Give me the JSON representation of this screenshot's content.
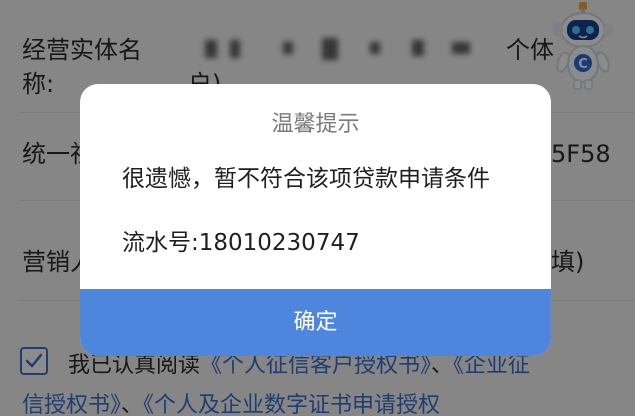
{
  "form": {
    "entity_name_label_line1": "经营实体名",
    "entity_name_label_line2": "称:",
    "entity_name_value_tail": "个体",
    "entity_name_value_line2": "户)",
    "credit_code_label": "统一社",
    "credit_code_value_tail": "5F58",
    "marketing_label": "营销人",
    "marketing_value_tail": "填)",
    "agree_prefix": "我已认真阅读",
    "agree_link_1": "《个人征信客户授权书》",
    "agree_separator": "、",
    "agree_link_2": "《企业征",
    "agree_link_2_cont": "信授权书》",
    "agree_separator_2": "、",
    "agree_link_3": "《个人及企业数字证书申请授权"
  },
  "checkbox": {
    "checked": true
  },
  "mascot": {
    "icon": "robot-mascot-icon",
    "badge_letter": "C"
  },
  "dialog": {
    "title": "温馨提示",
    "message": "很遗憾，暂不符合该项贷款申请条件",
    "serial": "流水号:18010230747",
    "confirm_label": "确定"
  },
  "colors": {
    "accent": "#4e86de",
    "link": "#3a6fd0",
    "overlay": "rgba(0,0,0,0.45)"
  }
}
